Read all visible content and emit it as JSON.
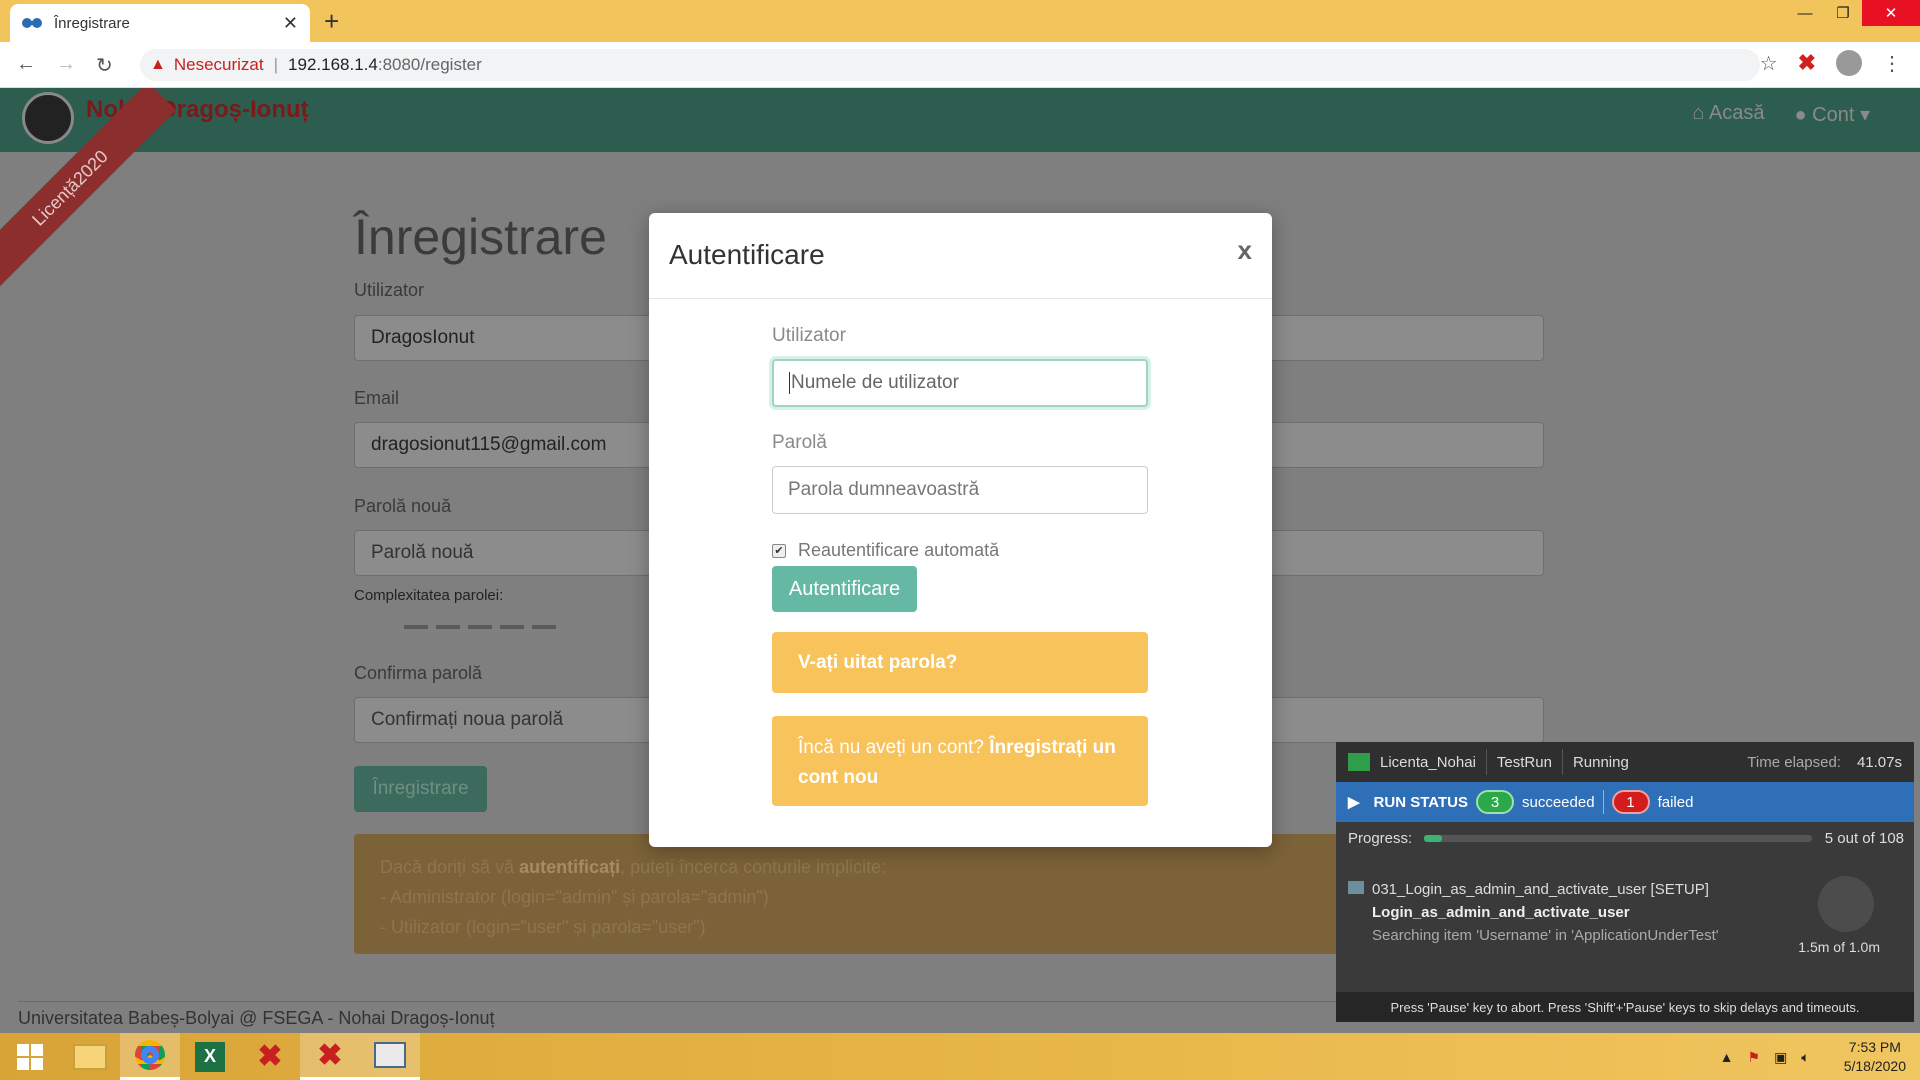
{
  "browser": {
    "tab_title": "Înregistrare",
    "new_tab": "+",
    "insecure_label": "Nesecurizat",
    "separator": "|",
    "url_host": "192.168.1.4",
    "url_rest": ":8080/register"
  },
  "site": {
    "brand": "Nohai Dragoș-Ionuț",
    "ribbon": "Licență2020",
    "nav_home": "Acasă",
    "nav_account": "Cont"
  },
  "register_form": {
    "title": "Înregistrare",
    "user_label": "Utilizator",
    "user_value": "DragosIonut",
    "email_label": "Email",
    "email_value": "dragosionut115@gmail.com",
    "password_label": "Parolă nouă",
    "password_placeholder": "Parolă nouă",
    "complexity_label": "Complexitatea parolei:",
    "confirm_label": "Confirma parolă",
    "confirm_placeholder": "Confirmați noua parolă",
    "submit": "Înregistrare",
    "alert_line1_a": "Dacă doriți să vă ",
    "alert_line1_b": "autentificați",
    "alert_line1_c": ", puteți încerca conturile implicite:",
    "alert_line2": "- Administrator (login=\"admin\" și parola=\"admin\")",
    "alert_line3": "- Utilizator (login=\"user\" și parola=\"user\")"
  },
  "footer": "Universitatea Babeș-Bolyai @ FSEGA - Nohai Dragoș-Ionuț",
  "login_modal": {
    "title": "Autentificare",
    "close": "x",
    "user_label": "Utilizator",
    "user_placeholder": "Numele de utilizator",
    "password_label": "Parolă",
    "password_placeholder": "Parola dumneavoastră",
    "remember_label": "Reautentificare automată",
    "remember_checked": true,
    "submit": "Autentificare",
    "forgot": "V-ați uitat parola?",
    "no_account": "Încă nu aveți un cont?",
    "register_link": "Înregistrați un cont nou"
  },
  "ranorex": {
    "project": "Licenta_Nohai",
    "test": "TestRun",
    "state": "Running",
    "elapsed_label": "Time elapsed:",
    "elapsed": "41.07s",
    "run_status": "RUN STATUS",
    "succeeded_count": "3",
    "succeeded_label": "succeeded",
    "failed_count": "1",
    "failed_label": "failed",
    "progress_label": "Progress:",
    "progress_text": "5 out of 108",
    "progress_fraction": 0.046,
    "item_title": "031_Login_as_admin_and_activate_user [SETUP]",
    "item_module": "Login_as_admin_and_activate_user",
    "item_action": "Searching item 'Username' in 'ApplicationUnderTest'",
    "item_time": "1.5m of 1.0m",
    "footer": "Press 'Pause' key to abort. Press 'Shift'+'Pause' keys to skip delays and timeouts."
  },
  "taskbar": {
    "time": "7:53 PM",
    "date": "5/18/2020"
  },
  "colors": {
    "accent": "#64b8a4",
    "warning": "#f9c35c",
    "navbar": "#2c5d4e"
  }
}
